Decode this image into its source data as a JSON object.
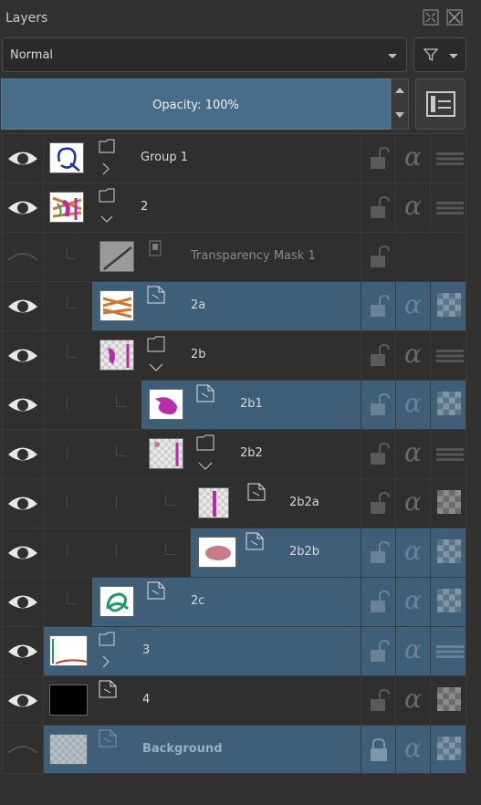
{
  "panel": {
    "title": "Layers"
  },
  "blend_mode": {
    "value": "Normal"
  },
  "opacity": {
    "label": "Opacity:  100%"
  },
  "layers": [
    {
      "name": "Group 1"
    },
    {
      "name": "2"
    },
    {
      "name": "Transparency Mask 1"
    },
    {
      "name": "2a"
    },
    {
      "name": "2b"
    },
    {
      "name": "2b1"
    },
    {
      "name": "2b2"
    },
    {
      "name": "2b2a"
    },
    {
      "name": "2b2b"
    },
    {
      "name": "2c"
    },
    {
      "name": "3"
    },
    {
      "name": "4"
    },
    {
      "name": "Background"
    }
  ],
  "colors": {
    "selection": "#3e5f77",
    "opacity_bar": "#476d8a",
    "panel_bg": "#313131"
  }
}
